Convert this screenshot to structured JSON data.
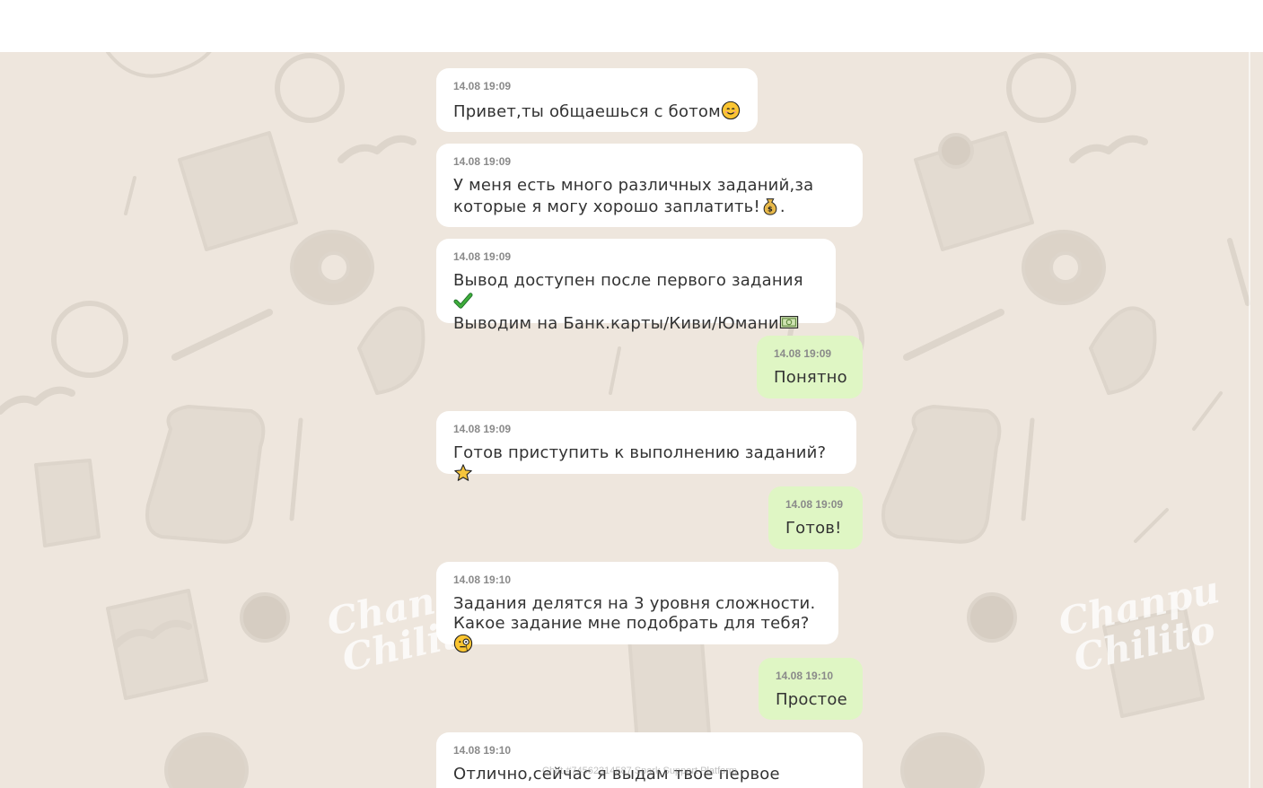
{
  "messages": [
    {
      "direction": "in",
      "time": "14.08 19:09",
      "text": "Привет,ты общаешься с ботом",
      "emoji": "smiling-face-icon"
    },
    {
      "direction": "in",
      "time": "14.08 19:09",
      "line1": "У меня есть много различных заданий,за",
      "line2": "которые я могу хорошо заплатить!",
      "line2_suffix": ".",
      "emoji": "money-bag-icon"
    },
    {
      "direction": "in",
      "time": "14.08 19:09",
      "line1": "Вывод доступен после первого задания",
      "line2": "Выводим на Банк.карты/Киви/Юмани",
      "emoji1": "check-mark-icon",
      "emoji2": "dollar-banknote-icon"
    },
    {
      "direction": "out",
      "time": "14.08 19:09",
      "text": "Понятно"
    },
    {
      "direction": "in",
      "time": "14.08 19:09",
      "text": "Готов приступить к выполнению заданий?",
      "emoji": "star-icon"
    },
    {
      "direction": "out",
      "time": "14.08 19:09",
      "text": "Готов!"
    },
    {
      "direction": "in",
      "time": "14.08 19:10",
      "line1": "Задания делятся на 3 уровня сложности.",
      "line2": "Какое задание мне подобрать для тебя?",
      "emoji": "face-with-monocle-icon"
    },
    {
      "direction": "out",
      "time": "14.08 19:10",
      "text": "Простое"
    },
    {
      "direction": "in",
      "time": "14.08 19:10",
      "line1": "Отлично,сейчас я выдам твое первое"
    }
  ],
  "footer": "Chat #74562314587 Spark Support Platform",
  "colors": {
    "background": "#eee6dd",
    "incoming_bubble": "#ffffff",
    "outgoing_bubble": "#dff6c4",
    "timestamp": "#8a8a8a",
    "text": "#333333"
  }
}
